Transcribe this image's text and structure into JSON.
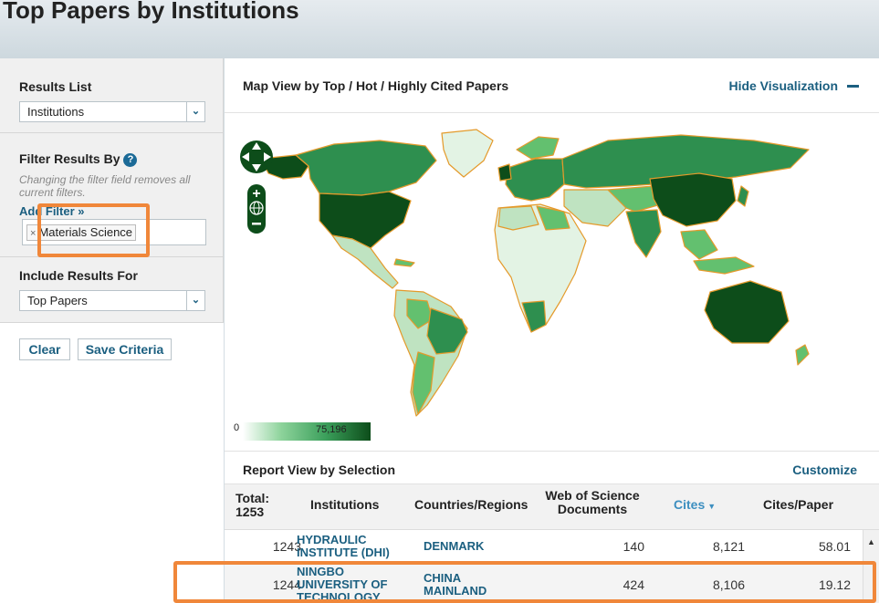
{
  "header": {
    "title": "Top Papers by Institutions"
  },
  "sidebar": {
    "results_list": {
      "label": "Results List",
      "value": "Institutions"
    },
    "filter": {
      "label": "Filter Results By",
      "help_icon": "question-circle-icon",
      "note": "Changing the filter field removes all current filters.",
      "add_filter": "Add Filter »",
      "token": "Materials Science",
      "remove_token": "×"
    },
    "include": {
      "label": "Include Results For",
      "value": "Top Papers"
    },
    "buttons": {
      "clear": "Clear",
      "save": "Save Criteria"
    }
  },
  "map": {
    "title": "Map View by Top / Hot / Highly Cited Papers",
    "hide_label": "Hide Visualization",
    "legend_min": "0",
    "legend_max": "75,196",
    "controls": [
      "pan-up-icon",
      "pan-left-icon",
      "pan-right-icon",
      "pan-down-icon",
      "zoom-in-icon",
      "globe-icon",
      "zoom-out-icon"
    ],
    "colors": {
      "dark": "#0d4d1a",
      "mid": "#2e8f4f",
      "light": "#63c06f",
      "pale": "#bfe3c1",
      "outline": "#e49a2b"
    }
  },
  "report": {
    "title": "Report View by Selection",
    "customize": "Customize",
    "total_label": "Total:",
    "total_value": "1253",
    "columns": [
      "Institutions",
      "Countries/Regions",
      "Web of Science",
      "Documents",
      "Cites",
      "Cites/Paper"
    ],
    "rows": [
      {
        "rank": "1243",
        "inst": [
          "HYDRAULIC",
          "INSTITUTE (DHI)"
        ],
        "country": [
          "DENMARK"
        ],
        "docs": "140",
        "cites": "8,121",
        "cpp": "58.01"
      },
      {
        "rank": "1244",
        "inst": [
          "NINGBO",
          "UNIVERSITY OF",
          "TECHNOLOGY"
        ],
        "country": [
          "CHINA",
          "MAINLAND"
        ],
        "docs": "424",
        "cites": "8,106",
        "cpp": "19.12"
      }
    ]
  }
}
